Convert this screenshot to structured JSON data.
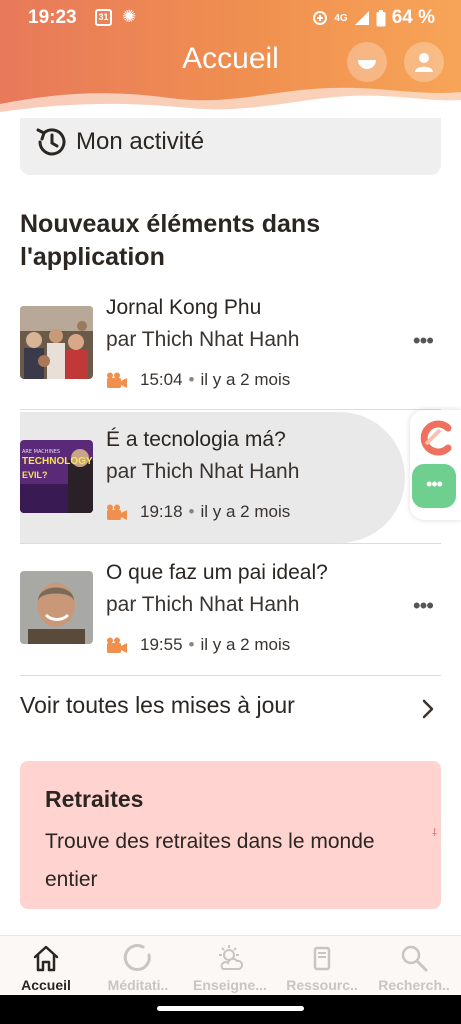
{
  "status_bar": {
    "time": "19:23",
    "calendar_day": "31",
    "network": "4G",
    "battery": "64 %"
  },
  "header": {
    "title": "Accueil",
    "theme_icon": "half-moon-icon",
    "profile_icon": "user-icon"
  },
  "activity": {
    "label": "Mon activité",
    "icon": "clock-history-icon"
  },
  "new_items": {
    "title": "Nouveaux éléments dans l'application",
    "items": [
      {
        "title": "Jornal Kong Phu",
        "author": "par Thich Nhat Hanh",
        "duration": "15:04",
        "age": "il y a 2 mois",
        "type_icon": "video-camera-icon"
      },
      {
        "title": "É a tecnologia má?",
        "author": "par Thich Nhat Hanh",
        "duration": "19:18",
        "age": "il y a 2 mois",
        "type_icon": "video-camera-icon",
        "thumb_text": [
          "TECHNOLOGY",
          "EVIL?"
        ]
      },
      {
        "title": "O que faz um pai ideal?",
        "author": "par Thich Nhat Hanh",
        "duration": "19:55",
        "age": "il y a 2 mois",
        "type_icon": "video-camera-icon"
      }
    ],
    "more_label": "•••"
  },
  "see_all": {
    "label": "Voir toutes les mises à jour"
  },
  "retreats": {
    "title": "Retraites",
    "description": "Trouve des retraites dans le monde entier"
  },
  "bottom_nav": {
    "items": [
      {
        "label": "Accueil",
        "icon": "home-icon",
        "active": true
      },
      {
        "label": "Méditati..",
        "icon": "circle-icon",
        "active": false
      },
      {
        "label": "Enseigne...",
        "icon": "sun-cloud-icon",
        "active": false
      },
      {
        "label": "Ressourc..",
        "icon": "book-icon",
        "active": false
      },
      {
        "label": "Recherch..",
        "icon": "search-icon",
        "active": false
      }
    ]
  },
  "colors": {
    "header_start": "#e8795a",
    "header_end": "#f7a458",
    "accent": "#f0904c",
    "retreats_bg": "#ffd3cf",
    "text": "#2b2622"
  }
}
